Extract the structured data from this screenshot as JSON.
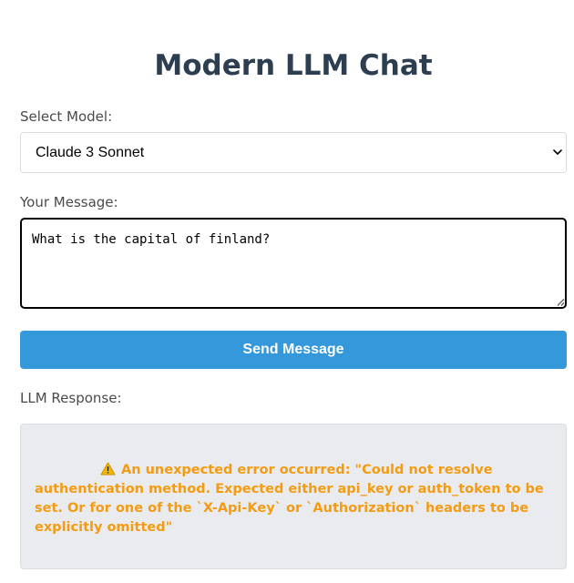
{
  "page": {
    "title": "Modern LLM Chat"
  },
  "model": {
    "label": "Select Model:",
    "selected": "Claude 3 Sonnet"
  },
  "message": {
    "label": "Your Message:",
    "value": "What is the capital of finland?"
  },
  "send_button": {
    "label": "Send Message"
  },
  "response": {
    "label": "LLM Response:",
    "icon": "warning-icon",
    "text": "An unexpected error occurred: \"Could not resolve authentication method. Expected either api_key or auth_token to be set. Or for one of the `X-Api-Key` or `Authorization` headers to be explicitly omitted\""
  },
  "colors": {
    "title": "#2c3e50",
    "accent": "#3498db",
    "error": "#f39c12",
    "response_bg": "#e9ebee"
  }
}
